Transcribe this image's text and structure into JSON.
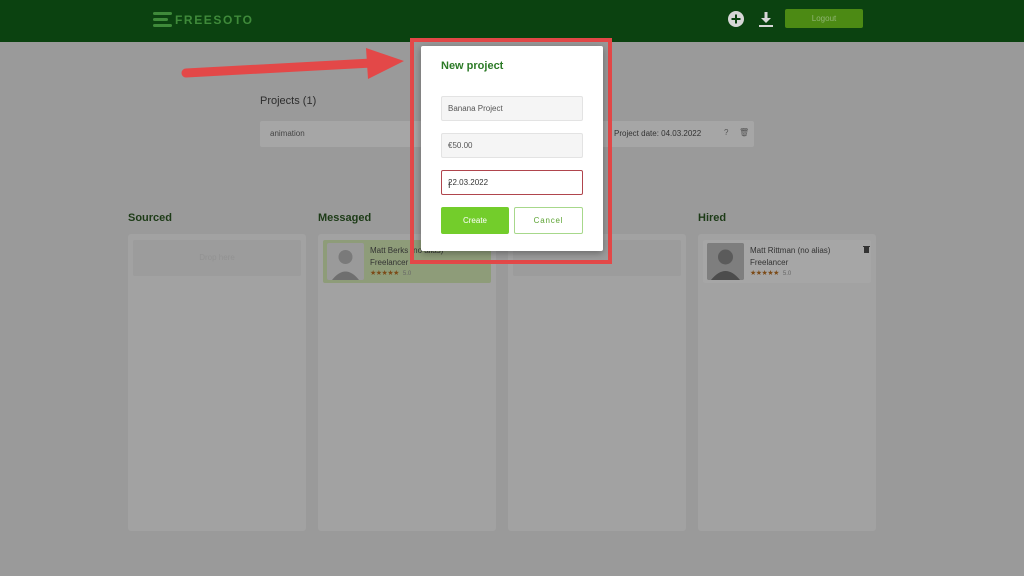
{
  "header": {
    "brand": "FREESOTO",
    "logout_label": "Logout"
  },
  "projects": {
    "heading": "Projects (1)",
    "items": [
      {
        "name": "animation",
        "date": "Project date: 04.03.2022"
      }
    ]
  },
  "board": {
    "columns": [
      {
        "title": "Sourced",
        "placeholder": "Drop here"
      },
      {
        "title": "Messaged"
      },
      {
        "title": ""
      },
      {
        "title": "Hired"
      }
    ],
    "messaged_card": {
      "name": "Matt Berks (no alias)",
      "role": "Freelancer",
      "stars": "★★★★★",
      "rating": "5.0"
    },
    "hired_card": {
      "name": "Matt Rittman (no alias)",
      "role": "Freelancer",
      "stars": "★★★★★",
      "rating": "5.0"
    }
  },
  "modal": {
    "title": "New project",
    "name_value": "Banana Project",
    "budget_value": "€50.00",
    "date_value": "22.03.2022",
    "create_label": "Create",
    "cancel_label": "Cancel"
  },
  "colors": {
    "header_bg": "#0b4210",
    "accent_green": "#73cd2b",
    "title_green": "#2b7a26",
    "highlight_red": "#e34848"
  }
}
